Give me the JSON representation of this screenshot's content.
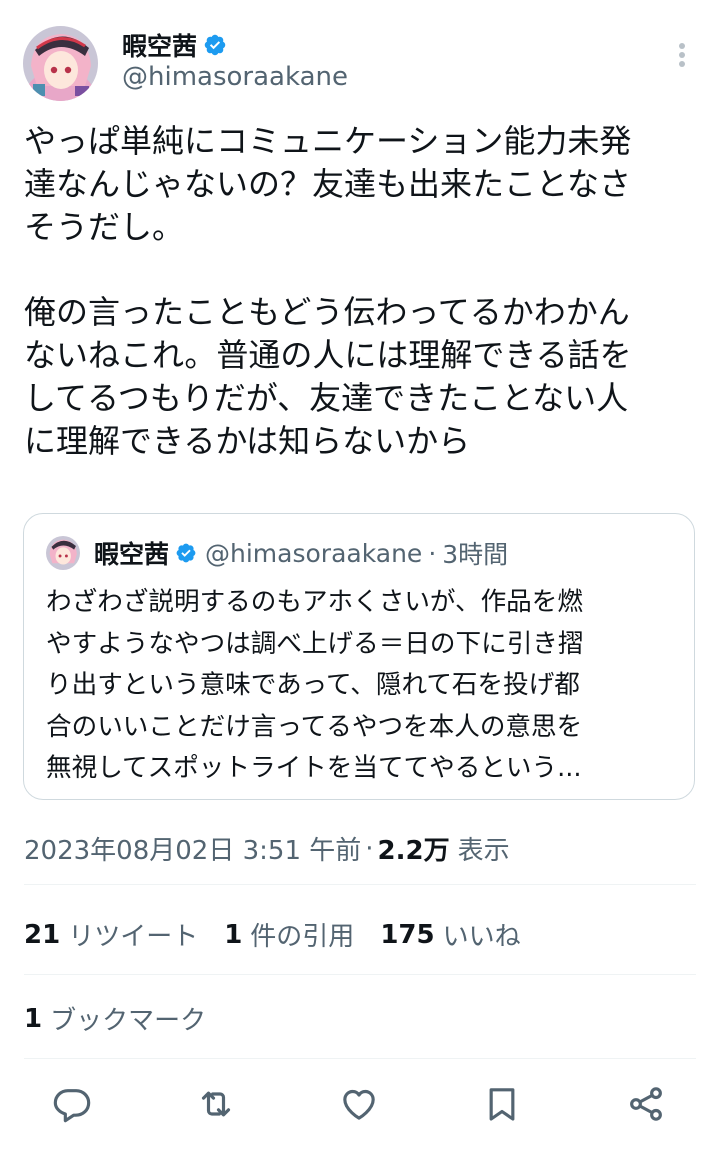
{
  "author": {
    "display_name": "暇空茜",
    "handle": "@himasoraakane",
    "verified_icon": "verified-badge-icon"
  },
  "tweet": {
    "text": "やっぱ単純にコミュニケーション能力未発\n達なんじゃないの？友達も出来たことなさ\nそうだし。\n\n俺の言ったこともどう伝わってるかわかん\nないねこれ。普通の人には理解できる話を\nしてるつもりだが、友達できたことない人\nに理解できるかは知らないから"
  },
  "quote": {
    "display_name": "暇空茜",
    "handle": "@himasoraakane",
    "separator": "·",
    "time": "3時間",
    "text": "わざわざ説明するのもアホくさいが、作品を燃\nやすようなやつは調べ上げる＝日の下に引き摺\nり出すという意味であって、隠れて石を投げ都\n合のいいことだけ言ってるやつを本人の意思を\n無視してスポットライトを当ててやるという..."
  },
  "meta": {
    "timestamp": "2023年08月02日 3:51 午前",
    "separator": "·",
    "views_count": "2.2万",
    "views_label": "表示"
  },
  "stats": {
    "retweets_count": "21",
    "retweets_label": "リツイート",
    "quotes_count": "1",
    "quotes_label": "件の引用",
    "likes_count": "175",
    "likes_label": "いいね",
    "bookmarks_count": "1",
    "bookmarks_label": "ブックマーク"
  },
  "actions": [
    "reply-icon",
    "retweet-icon",
    "like-icon",
    "bookmark-icon",
    "share-icon"
  ],
  "colors": {
    "text": "#0f1419",
    "secondary": "#536471",
    "verified": "#1d9bf0",
    "border": "#cfd9de",
    "divider": "#eff3f4"
  }
}
